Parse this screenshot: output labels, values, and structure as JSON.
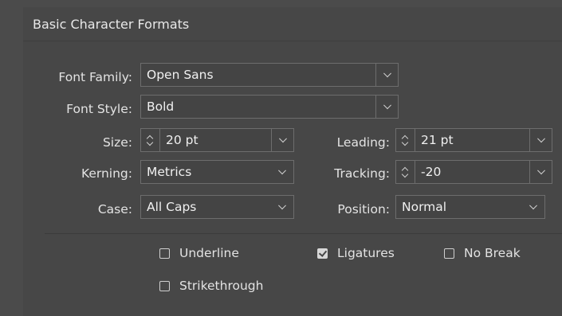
{
  "panel": {
    "title": "Basic Character Formats",
    "font_family": {
      "label": "Font Family:",
      "value": "Open Sans"
    },
    "font_style": {
      "label": "Font Style:",
      "value": "Bold"
    },
    "size": {
      "label": "Size:",
      "value": "20 pt"
    },
    "leading": {
      "label": "Leading:",
      "value": "21 pt"
    },
    "kerning": {
      "label": "Kerning:",
      "value": "Metrics"
    },
    "tracking": {
      "label": "Tracking:",
      "value": "-20"
    },
    "case": {
      "label": "Case:",
      "value": "All Caps"
    },
    "position": {
      "label": "Position:",
      "value": "Normal"
    },
    "checkboxes": {
      "underline": {
        "label": "Underline",
        "checked": false
      },
      "ligatures": {
        "label": "Ligatures",
        "checked": true
      },
      "no_break": {
        "label": "No Break",
        "checked": false
      },
      "strikethrough": {
        "label": "Strikethrough",
        "checked": false
      }
    }
  },
  "colors": {
    "panel_bg": "#474747",
    "field_border": "#6d6d6d",
    "text": "#e3e3e3"
  }
}
